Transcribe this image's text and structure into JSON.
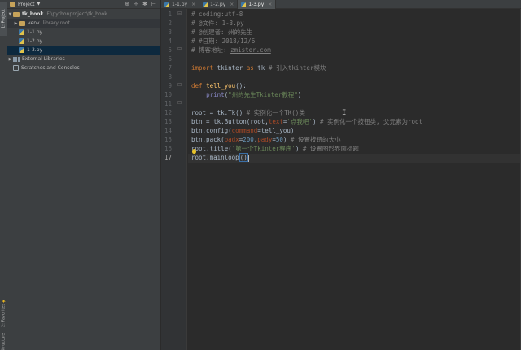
{
  "sidebar_tabs": {
    "project": "1: Project",
    "favorites": "2: Favorites",
    "structure": "Structure"
  },
  "project": {
    "title": "Project",
    "header_actions": [
      "⊕",
      "÷",
      "✱",
      "⊢"
    ],
    "root_name": "tk_book",
    "root_path": "F:\\pythonproject\\tk_book",
    "venv_name": "venv",
    "venv_note": "library root",
    "files": [
      "1-1.py",
      "1-2.py",
      "1-3.py"
    ],
    "external_libraries": "External Libraries",
    "scratches": "Scratches and Consoles"
  },
  "tabs": [
    {
      "label": "1-1.py",
      "active": false
    },
    {
      "label": "1-2.py",
      "active": false
    },
    {
      "label": "1-3.py",
      "active": true
    }
  ],
  "tab_close": "×",
  "line_numbers": [
    "1",
    "2",
    "3",
    "4",
    "5",
    "6",
    "7",
    "8",
    "9",
    "10",
    "11",
    "12",
    "13",
    "14",
    "15",
    "16",
    "17"
  ],
  "code": {
    "l1": "# coding:utf-8",
    "l2": "# @文件: 1-3.py",
    "l3": "# @创建者: 州的先生",
    "l4": "# #日期: 2018/12/6",
    "l5a": "# 博客地址: ",
    "l5b": "zmister.com",
    "l7a": "import",
    "l7b": " tkinter ",
    "l7c": "as",
    "l7d": " tk ",
    "l7e": "# 引入tkinter模块",
    "l9a": "def",
    "l9b": "tell_you",
    "l9c": "():",
    "l10a": "    ",
    "l10b": "print",
    "l10c": "(",
    "l10d": "\"州的先生Tkinter教程\"",
    "l10e": ")",
    "l12a": "root = tk.Tk() ",
    "l12b": "# 实例化一个TK()类",
    "l13a": "btn = tk.Button(root,",
    "l13b": "text",
    "l13c": "=",
    "l13d": "'点我吧'",
    "l13e": ") ",
    "l13f": "# 实例化一个按钮类, 父元素为root",
    "l14a": "btn.config(",
    "l14b": "command",
    "l14c": "=tell_you)",
    "l15a": "btn.pack(",
    "l15b": "padx",
    "l15c": "=",
    "l15d": "200",
    "l15e": ",",
    "l15f": "pady",
    "l15g": "=",
    "l15h": "50",
    "l15i": ") ",
    "l15j": "# 设置按钮的大小",
    "l16a": "root.title(",
    "l16b": "'第一个Tkinter程序'",
    "l16c": ") ",
    "l16d": "# 设置图形界面标题",
    "l17a": "root.mainloop",
    "l17b": "()"
  },
  "colors": {
    "keyword": "#cc7832",
    "string": "#6a8759",
    "comment": "#808080",
    "number": "#6897bb",
    "function": "#ffc66d",
    "param": "#aa4926"
  }
}
